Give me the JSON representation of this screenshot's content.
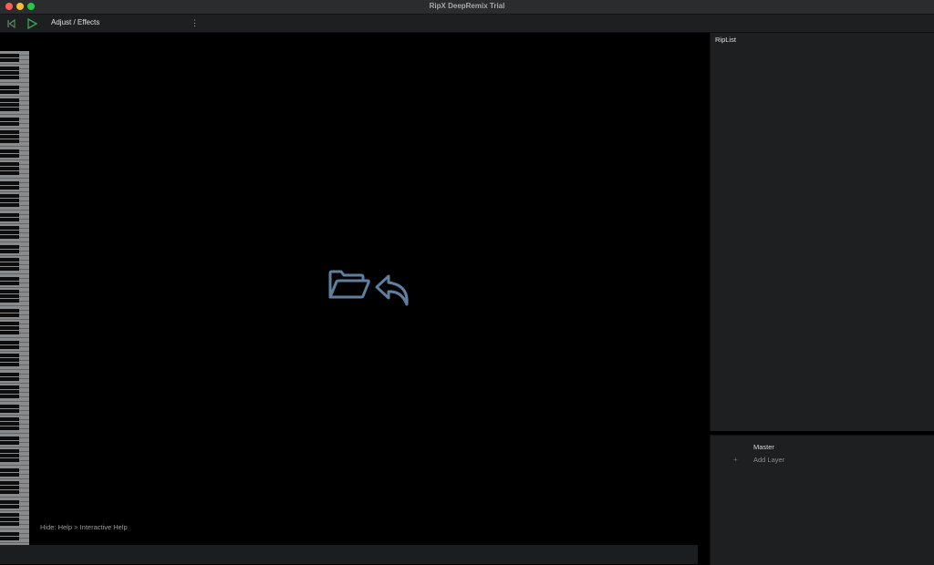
{
  "window": {
    "title": "RipX DeepRemix Trial"
  },
  "toolbar": {
    "back_icon": "skip-to-start-icon",
    "play_icon": "play-icon",
    "menu_label": "Adjust / Effects",
    "more_icon": "vertical-ellipsis-icon",
    "more_glyph": "⋮",
    "play_color": "#3fa34d"
  },
  "editor": {
    "open_icon": "open-folder-icon",
    "undo_icon": "undo-arrow-icon",
    "icon_color": "#5f7f9f",
    "help_text": "Hide: Help > Interactive Help"
  },
  "ripl_panel": {
    "title": "RipList"
  },
  "layers": {
    "master_label": "Master",
    "add_glyph": "+",
    "add_label": "Add Layer"
  }
}
